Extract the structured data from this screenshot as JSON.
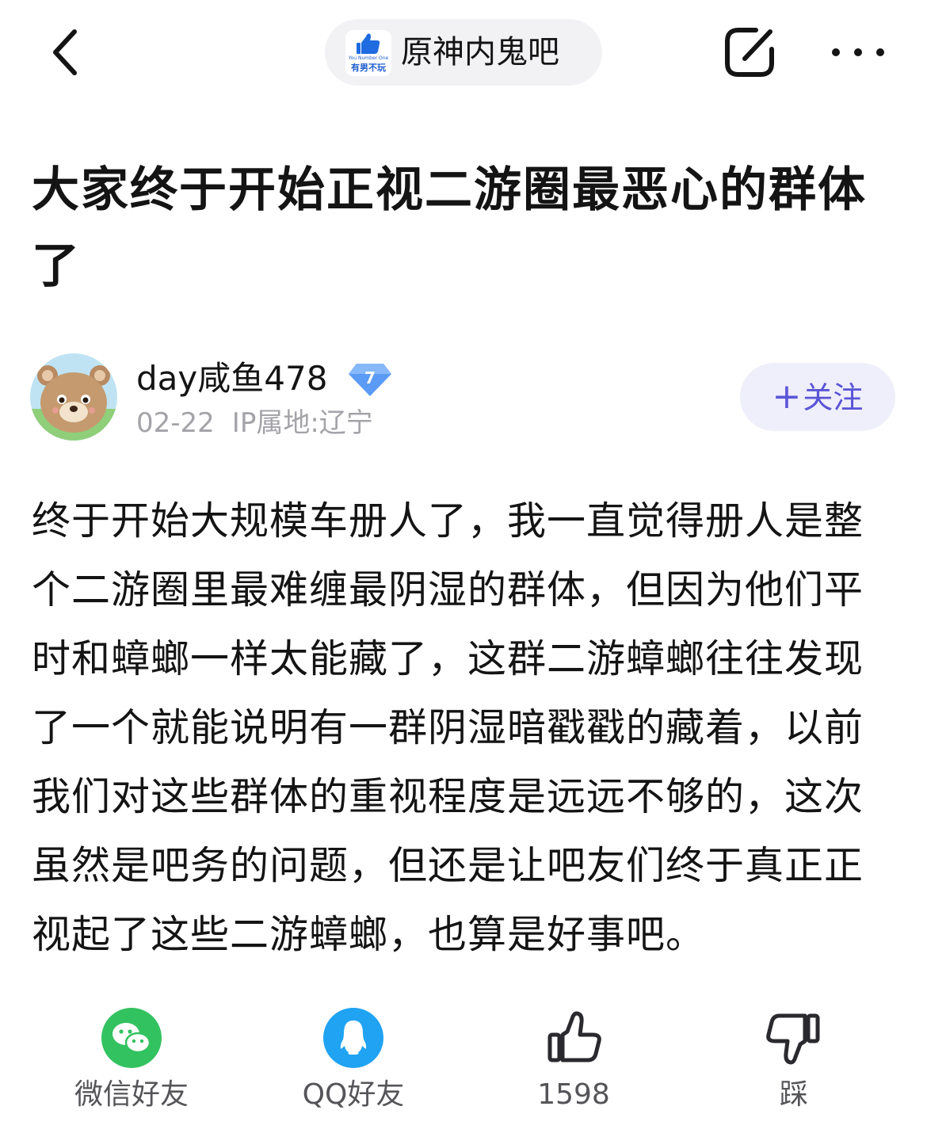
{
  "header": {
    "forum_name": "原神内鬼吧",
    "forum_logo_tag": "You Number One",
    "forum_logo_text": "有男不玩",
    "icons": [
      "back-chevron-icon",
      "forum-logo",
      "edit-icon",
      "more-dots-icon"
    ]
  },
  "post": {
    "title": "大家终于开始正视二游圈最恶心的群体了",
    "author": {
      "name": "day咸鱼478",
      "level": "7",
      "date": "02-22",
      "ip_location": "IP属地:辽宁",
      "follow_label": "关注",
      "follow_plus": "+"
    },
    "body": "终于开始大规模车册人了，我一直觉得册人是整个二游圈里最难缠最阴湿的群体，但因为他们平时和蟑螂一样太能藏了，这群二游蟑螂往往发现了一个就能说明有一群阴湿暗戳戳的藏着，以前我们对这些群体的重视程度是远远不够的，这次虽然是吧务的问题，但还是让吧友们终于真正正视起了这些二游蟑螂，也算是好事吧。"
  },
  "actions": {
    "wechat_label": "微信好友",
    "qq_label": "QQ好友",
    "like_count": "1598",
    "dislike_label": "踩"
  },
  "colors": {
    "accent": "#5a55d6",
    "follow_bg": "#efeefb",
    "wechat_green": "#33c260",
    "qq_blue": "#1fa3f2",
    "muted_text": "#a3a3a8",
    "badge_blue": "#4f8ff3"
  }
}
